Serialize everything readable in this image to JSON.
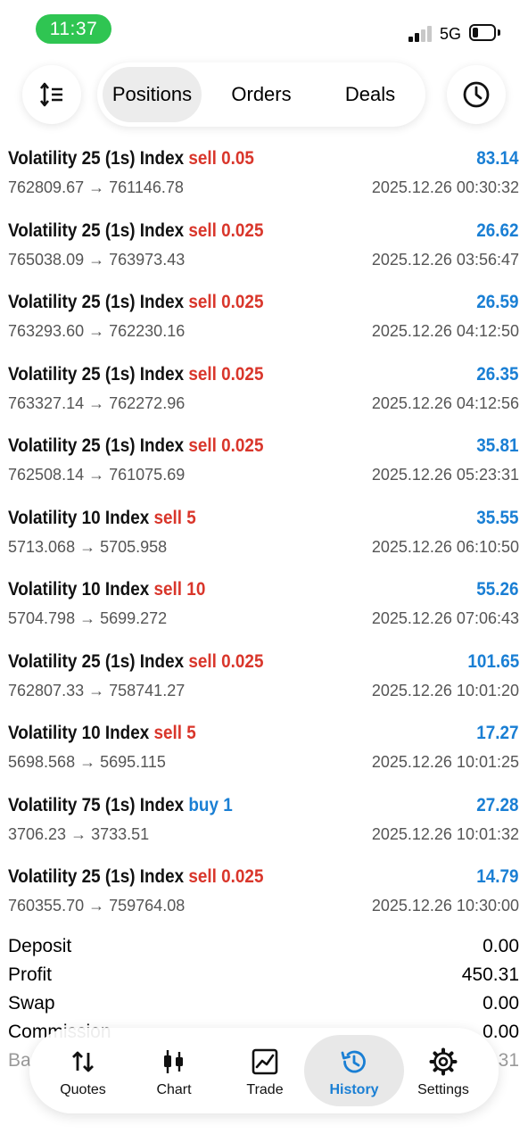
{
  "status_bar": {
    "time": "11:37",
    "network": "5G"
  },
  "top_nav": {
    "tabs": {
      "positions": "Positions",
      "orders": "Orders",
      "deals": "Deals"
    },
    "active_tab": "Positions"
  },
  "deals": [
    {
      "symbol": "Volatility 25 (1s) Index",
      "side": "sell",
      "volume": "0.05",
      "profit": "83.14",
      "open_price": "762809.67",
      "close_price": "761146.78",
      "time": "2025.12.26 00:30:32"
    },
    {
      "symbol": "Volatility 25 (1s) Index",
      "side": "sell",
      "volume": "0.025",
      "profit": "26.62",
      "open_price": "765038.09",
      "close_price": "763973.43",
      "time": "2025.12.26 03:56:47"
    },
    {
      "symbol": "Volatility 25 (1s) Index",
      "side": "sell",
      "volume": "0.025",
      "profit": "26.59",
      "open_price": "763293.60",
      "close_price": "762230.16",
      "time": "2025.12.26 04:12:50"
    },
    {
      "symbol": "Volatility 25 (1s) Index",
      "side": "sell",
      "volume": "0.025",
      "profit": "26.35",
      "open_price": "763327.14",
      "close_price": "762272.96",
      "time": "2025.12.26 04:12:56"
    },
    {
      "symbol": "Volatility 25 (1s) Index",
      "side": "sell",
      "volume": "0.025",
      "profit": "35.81",
      "open_price": "762508.14",
      "close_price": "761075.69",
      "time": "2025.12.26 05:23:31"
    },
    {
      "symbol": "Volatility 10 Index",
      "side": "sell",
      "volume": "5",
      "profit": "35.55",
      "open_price": "5713.068",
      "close_price": "5705.958",
      "time": "2025.12.26 06:10:50"
    },
    {
      "symbol": "Volatility 10 Index",
      "side": "sell",
      "volume": "10",
      "profit": "55.26",
      "open_price": "5704.798",
      "close_price": "5699.272",
      "time": "2025.12.26 07:06:43"
    },
    {
      "symbol": "Volatility 25 (1s) Index",
      "side": "sell",
      "volume": "0.025",
      "profit": "101.65",
      "open_price": "762807.33",
      "close_price": "758741.27",
      "time": "2025.12.26 10:01:20"
    },
    {
      "symbol": "Volatility 10 Index",
      "side": "sell",
      "volume": "5",
      "profit": "17.27",
      "open_price": "5698.568",
      "close_price": "5695.115",
      "time": "2025.12.26 10:01:25"
    },
    {
      "symbol": "Volatility 75 (1s) Index",
      "side": "buy",
      "volume": "1",
      "profit": "27.28",
      "open_price": "3706.23",
      "close_price": "3733.51",
      "time": "2025.12.26 10:01:32"
    },
    {
      "symbol": "Volatility 25 (1s) Index",
      "side": "sell",
      "volume": "0.025",
      "profit": "14.79",
      "open_price": "760355.70",
      "close_price": "759764.08",
      "time": "2025.12.26 10:30:00"
    }
  ],
  "summary": {
    "deposit": {
      "label": "Deposit",
      "value": "0.00"
    },
    "profit": {
      "label": "Profit",
      "value": "450.31"
    },
    "swap": {
      "label": "Swap",
      "value": "0.00"
    },
    "commission": {
      "label": "Commission",
      "value": "0.00"
    },
    "balance": {
      "label": "Ba",
      "value": "31"
    }
  },
  "bottom_tabs": {
    "quotes": "Quotes",
    "chart": "Chart",
    "trade": "Trade",
    "history": "History",
    "settings": "Settings",
    "active": "History"
  },
  "colors": {
    "sell": "#d9362b",
    "buy": "#1a7fd4",
    "profit": "#1a7fd4",
    "accent": "#1a7fd4",
    "status_time_pill": "#2fc552"
  },
  "icons": {
    "sort": "sort-lines-icon",
    "history_top": "clock-icon",
    "quotes": "up-down-arrows-icon",
    "chart": "candlestick-icon",
    "trade": "line-chart-icon",
    "history": "history-clock-icon",
    "settings": "gear-icon"
  }
}
